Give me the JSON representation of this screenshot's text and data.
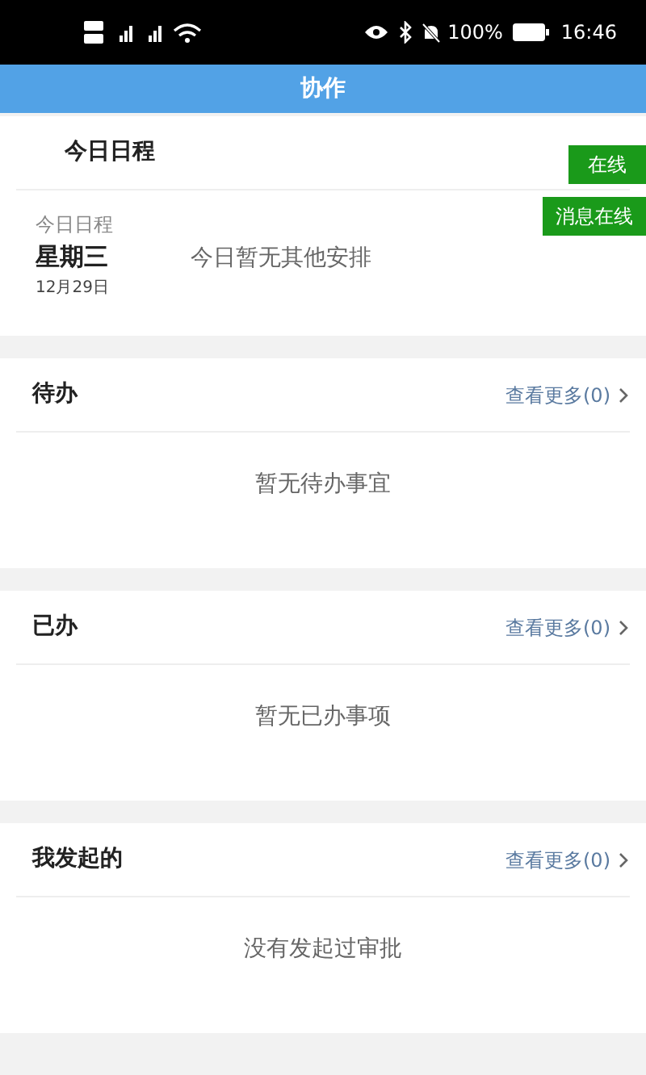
{
  "status_bar": {
    "battery": "100%",
    "time": "16:46"
  },
  "header": {
    "title": "协作"
  },
  "schedule": {
    "title": "今日日程",
    "online_badge": "在线",
    "message_badge": "消息在线",
    "label": "今日日程",
    "weekday": "星期三",
    "date": "12月29日",
    "empty": "今日暂无其他安排"
  },
  "sections": [
    {
      "title": "待办",
      "more": "查看更多(0)",
      "empty": "暂无待办事宜"
    },
    {
      "title": "已办",
      "more": "查看更多(0)",
      "empty": "暂无已办事项"
    },
    {
      "title": "我发起的",
      "more": "查看更多(0)",
      "empty": "没有发起过审批"
    }
  ]
}
